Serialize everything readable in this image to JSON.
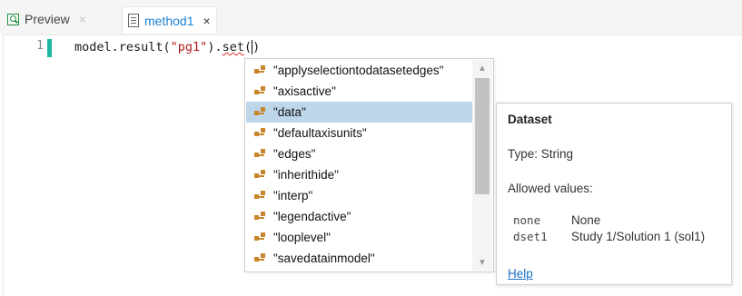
{
  "tabs": [
    {
      "label": "Preview",
      "close": "×",
      "icon": "preview-icon",
      "active": false
    },
    {
      "label": "method1",
      "close": "×",
      "icon": "document-icon",
      "active": true
    }
  ],
  "editor": {
    "line_number": "1",
    "code": {
      "prefix": "model.result(",
      "string": "\"pg1\"",
      "middle": ").",
      "method": "set",
      "open_paren": "(",
      "close_paren": ")"
    }
  },
  "completion": {
    "items": [
      "\"applyselectiontodatasetedges\"",
      "\"axisactive\"",
      "\"data\"",
      "\"defaultaxisunits\"",
      "\"edges\"",
      "\"inherithide\"",
      "\"interp\"",
      "\"legendactive\"",
      "\"looplevel\"",
      "\"savedatainmodel\""
    ],
    "selected_index": 2,
    "item_icon": "property-icon",
    "scroll_up": "▲",
    "scroll_down": "▼"
  },
  "info": {
    "title": "Dataset",
    "type": "Type: String",
    "allowed_label": "Allowed values:",
    "values": [
      {
        "code": "none",
        "desc": "None"
      },
      {
        "code": "dset1",
        "desc": "Study 1/Solution 1 (sol1)"
      }
    ],
    "help": "Help"
  },
  "colors": {
    "accent": "#1a7fd0",
    "selection": "#bed6ea",
    "string": "#b31b1b",
    "change_marker": "#1fb5a3",
    "property_icon": "#c7862a"
  }
}
